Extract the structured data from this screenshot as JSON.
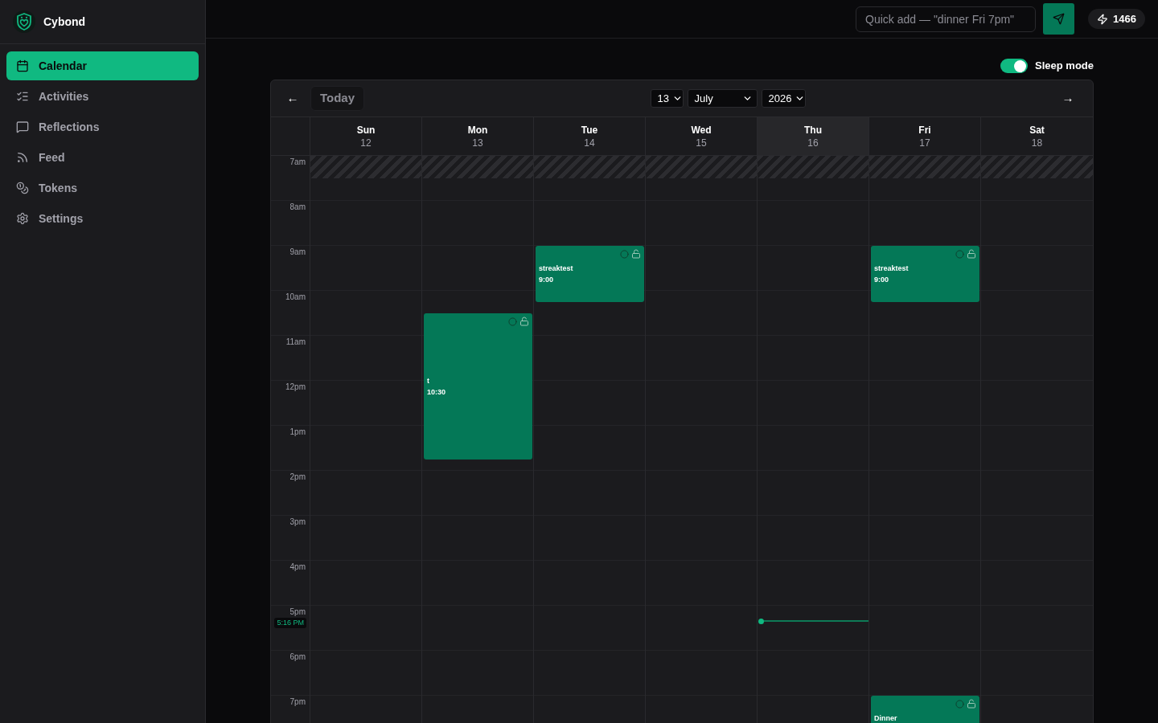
{
  "sidebar": {
    "brand": "Cybond",
    "items": [
      {
        "label": "Calendar",
        "selected": true
      },
      {
        "label": "Activities",
        "selected": false
      },
      {
        "label": "Reflections",
        "selected": false
      },
      {
        "label": "Feed",
        "selected": false
      },
      {
        "label": "Tokens",
        "selected": false
      },
      {
        "label": "Settings",
        "selected": false
      }
    ]
  },
  "top_bar": {
    "quick_add": {
      "placeholder": "Quick add — \"dinner Fri 7pm\""
    },
    "token_count": "1466"
  },
  "sleep_mode": {
    "label": "Sleep mode",
    "on": true
  },
  "calendar": {
    "prev": "←",
    "today_button": "Today",
    "day_select": "13",
    "month_select": "July",
    "year_select": "2026",
    "next": "→",
    "days": [
      {
        "name": "Sun",
        "date": "12",
        "today": false
      },
      {
        "name": "Mon",
        "date": "13",
        "today": false,
        "events": [
          {
            "title": "t",
            "time": "10:30",
            "completed": false,
            "locked": false
          }
        ]
      },
      {
        "name": "Tue",
        "date": "14",
        "today": false,
        "events": [
          {
            "title": "streaktest",
            "time": "9:00",
            "completed": false,
            "locked": false
          }
        ]
      },
      {
        "name": "Wed",
        "date": "15",
        "today": false
      },
      {
        "name": "Thu",
        "date": "16",
        "today": true
      },
      {
        "name": "Fri",
        "date": "17",
        "today": false,
        "events": [
          {
            "title": "streaktest",
            "time": "9:00",
            "completed": false,
            "locked": false
          },
          {
            "title": "Dinner",
            "completed": false,
            "locked": false
          }
        ]
      },
      {
        "name": "Sat",
        "date": "18",
        "today": false
      }
    ],
    "hours": [
      "7am",
      "8am",
      "9am",
      "10am",
      "11am",
      "12pm",
      "1pm",
      "2pm",
      "3pm",
      "4pm",
      "5pm",
      "6pm",
      "7pm"
    ],
    "now": {
      "label": "5:16 PM"
    }
  }
}
